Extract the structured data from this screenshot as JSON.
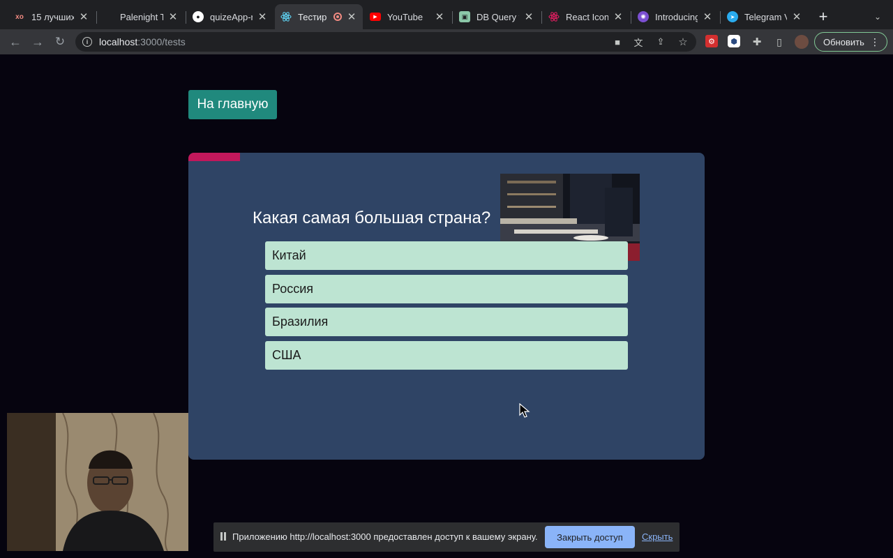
{
  "browser": {
    "tabs": [
      {
        "title": "15 лучших",
        "favicon": "xo",
        "favicon_color": "#e8eaed",
        "active": false
      },
      {
        "title": "Palenight T",
        "favicon": "ms",
        "favicon_color": "#f25022",
        "active": false
      },
      {
        "title": "quizeApp-r",
        "favicon": "github",
        "favicon_color": "#ffffff",
        "active": false
      },
      {
        "title": "Тестир",
        "favicon": "react",
        "favicon_color": "#61dafb",
        "active": true
      },
      {
        "title": "YouTube",
        "favicon": "youtube",
        "favicon_color": "#ff0000",
        "active": false
      },
      {
        "title": "DB Query v",
        "favicon": "db",
        "favicon_color": "#8bc7a8",
        "active": false
      },
      {
        "title": "React Icon",
        "favicon": "react",
        "favicon_color": "#e91e63",
        "active": false
      },
      {
        "title": "Introducing",
        "favicon": "openai",
        "favicon_color": "#b183f5",
        "active": false
      },
      {
        "title": "Telegram V",
        "favicon": "telegram",
        "favicon_color": "#2aabee",
        "active": false
      }
    ],
    "address": {
      "host": "localhost",
      "path": ":3000/tests"
    },
    "update_label": "Обновить"
  },
  "page": {
    "home_button": "На главную",
    "progress_percent": 10,
    "question": "Какая самая большая страна?",
    "answers": [
      "Китай",
      "Россия",
      "Бразилия",
      "США"
    ]
  },
  "share_bar": {
    "message": "Приложению http://localhost:3000 предоставлен доступ к вашему экрану.",
    "stop_label": "Закрыть доступ",
    "hide_label": "Скрыть"
  },
  "colors": {
    "page_bg": "#06040f",
    "card_bg": "#2f4465",
    "accent": "#20897d",
    "progress": "#c2185b",
    "answer_bg": "#bde4d2"
  }
}
